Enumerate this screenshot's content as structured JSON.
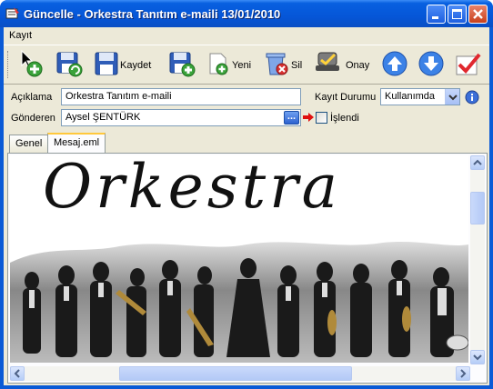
{
  "window": {
    "title": "Güncelle - Orkestra Tanıtım e-maili 13/01/2010"
  },
  "menu": {
    "items": [
      "Kayıt"
    ]
  },
  "toolbar": {
    "save_label": "Kaydet",
    "new_label": "Yeni",
    "delete_label": "Sil",
    "approve_label": "Onay"
  },
  "form": {
    "description_label": "Açıklama",
    "description_value": "Orkestra Tanıtım e-maili",
    "sender_label": "Gönderen",
    "sender_value": "Aysel ŞENTÜRK",
    "browse_label": "...",
    "status_label": "Kayıt Durumu",
    "status_value": "Kullanımda",
    "processed_label": "İşlendi",
    "processed_checked": false
  },
  "tabs": [
    {
      "label": "Genel",
      "active": false
    },
    {
      "label": "Mesaj.eml",
      "active": true
    }
  ],
  "message": {
    "headline": "Orkestra"
  },
  "colors": {
    "titlebar": "#0556d8",
    "accent_tab": "#ffc83c",
    "arrow_red": "#e01010"
  }
}
